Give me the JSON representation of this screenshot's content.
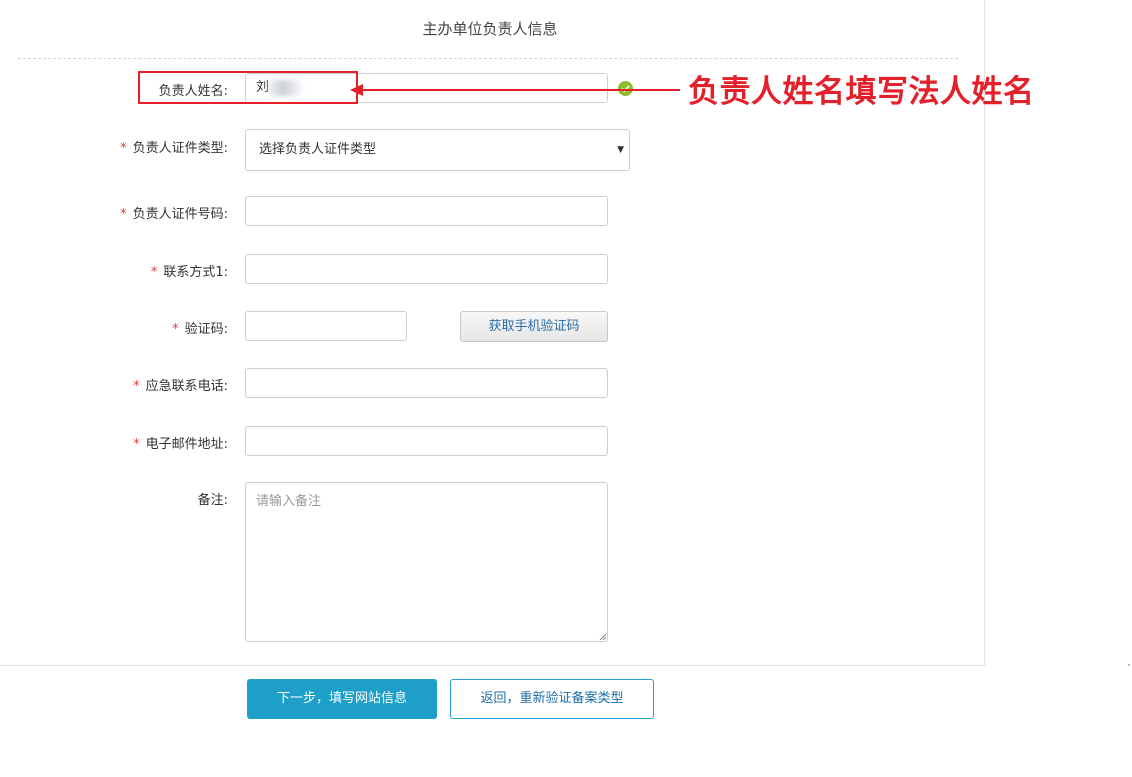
{
  "section": {
    "title": "主办单位负责人信息"
  },
  "fields": {
    "name": {
      "label": "负责人姓名:",
      "value": "刘  "
    },
    "id_type": {
      "required": "*",
      "label": "负责人证件类型:",
      "value": "选择负责人证件类型"
    },
    "id_number": {
      "required": "*",
      "label": "负责人证件号码:",
      "value": ""
    },
    "contact1": {
      "required": "*",
      "label": "联系方式1:",
      "value": ""
    },
    "captcha": {
      "required": "*",
      "label": "验证码:",
      "value": "",
      "button": "获取手机验证码"
    },
    "emergency": {
      "required": "*",
      "label": "应急联系电话:",
      "value": ""
    },
    "email": {
      "required": "*",
      "label": "电子邮件地址:",
      "value": ""
    },
    "remark": {
      "label": "备注:",
      "placeholder": "请输入备注"
    }
  },
  "buttons": {
    "next": "下一步，填写网站信息",
    "back": "返回，重新验证备案类型"
  },
  "annotation": {
    "text": "负责人姓名填写法人姓名",
    "color": "#e4202a"
  },
  "colors": {
    "primary": "#1d9fc9",
    "required": "#e4393c",
    "valid": "#8cbd2a"
  },
  "icons": {
    "valid": "check-circle-icon",
    "dropdown": "caret-down-icon"
  }
}
